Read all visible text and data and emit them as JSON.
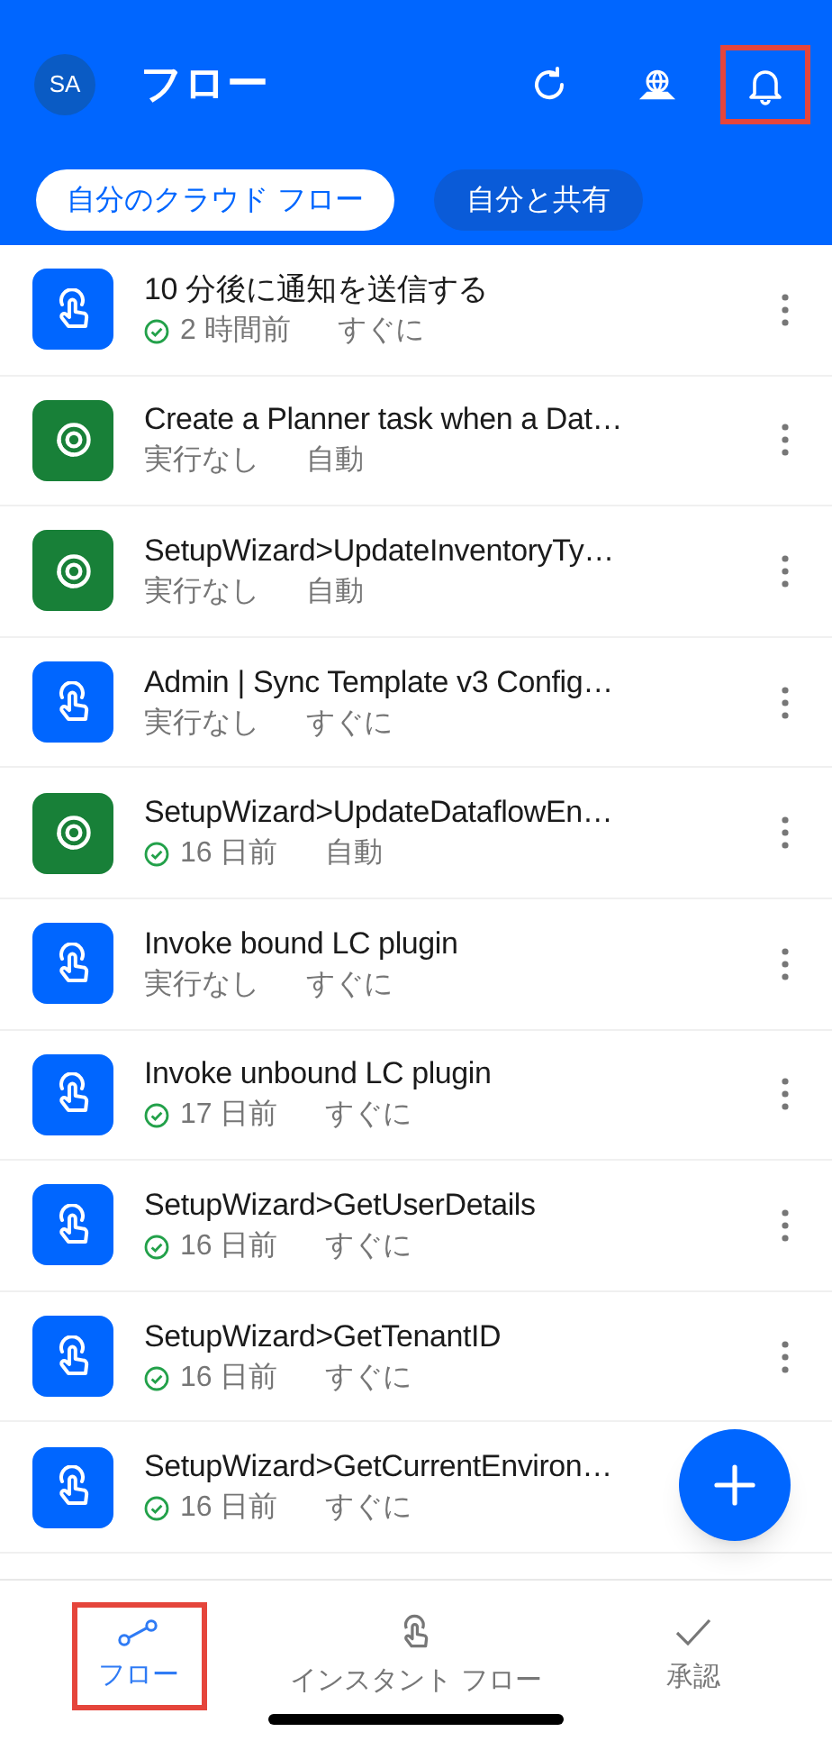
{
  "header": {
    "avatar": "SA",
    "title": "フロー",
    "actions": [
      {
        "kind": "refresh",
        "highlighted": false
      },
      {
        "kind": "environment",
        "highlighted": false
      },
      {
        "kind": "notifications",
        "highlighted": true
      }
    ]
  },
  "filters": [
    {
      "label": "自分のクラウド フロー",
      "selected": true
    },
    {
      "label": "自分と共有",
      "selected": false
    }
  ],
  "flows": [
    {
      "kind": "instant",
      "title": "10 分後に通知を送信する",
      "succeeded": true,
      "last_run": "2 時間前",
      "trigger": "すぐに"
    },
    {
      "kind": "automated",
      "title": "Create a Planner task when a Dat…",
      "succeeded": false,
      "last_run": "実行なし",
      "trigger": "自動"
    },
    {
      "kind": "automated",
      "title": "SetupWizard>UpdateInventoryTy…",
      "succeeded": false,
      "last_run": "実行なし",
      "trigger": "自動"
    },
    {
      "kind": "instant",
      "title": "Admin | Sync Template v3 Config…",
      "succeeded": false,
      "last_run": "実行なし",
      "trigger": "すぐに"
    },
    {
      "kind": "automated",
      "title": "SetupWizard>UpdateDataflowEn…",
      "succeeded": true,
      "last_run": "16 日前",
      "trigger": "自動"
    },
    {
      "kind": "instant",
      "title": "Invoke bound LC plugin",
      "succeeded": false,
      "last_run": "実行なし",
      "trigger": "すぐに"
    },
    {
      "kind": "instant",
      "title": "Invoke unbound LC plugin",
      "succeeded": true,
      "last_run": "17 日前",
      "trigger": "すぐに"
    },
    {
      "kind": "instant",
      "title": "SetupWizard>GetUserDetails",
      "succeeded": true,
      "last_run": "16 日前",
      "trigger": "すぐに"
    },
    {
      "kind": "instant",
      "title": "SetupWizard>GetTenantID",
      "succeeded": true,
      "last_run": "16 日前",
      "trigger": "すぐに"
    },
    {
      "kind": "instant",
      "title": "SetupWizard>GetCurrentEnviron…",
      "succeeded": true,
      "last_run": "16 日前",
      "trigger": "すぐに"
    }
  ],
  "bottom_nav": [
    {
      "kind": "flows",
      "label": "フロー",
      "selected": true,
      "highlighted": true
    },
    {
      "kind": "instant",
      "label": "インスタント フロー",
      "selected": false,
      "highlighted": false
    },
    {
      "kind": "approvals",
      "label": "承認",
      "selected": false,
      "highlighted": false
    }
  ]
}
